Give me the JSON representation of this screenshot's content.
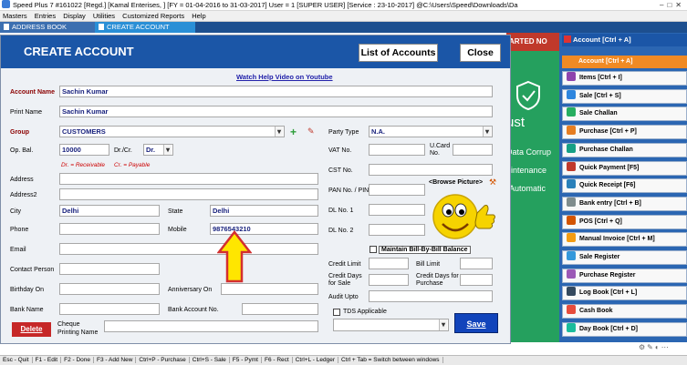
{
  "titlebar": {
    "text": "Speed Plus 7 #161022  [Regd.]  [Kamal Enterises, ]  [FY = 01-04-2016 to 31-03-2017]  User = 1 [SUPER USER]   [Service : 23-10-2017]  @C:\\Users\\Speed\\Downloads\\Da"
  },
  "menu": [
    "Masters",
    "Entries",
    "Display",
    "Utilities",
    "Customized Reports",
    "Help"
  ],
  "tabs": [
    "ADDRESS BOOK",
    "CREATE ACCOUNT"
  ],
  "dialog": {
    "title": "CREATE ACCOUNT",
    "list_btn": "List of Accounts",
    "close_btn": "Close",
    "help_link": "Watch Help Video on Youtube",
    "labels": {
      "account_name": "Account Name",
      "print_name": "Print Name",
      "group": "Group",
      "op_bal": "Op. Bal.",
      "drcr": "Dr./Cr.",
      "address": "Address",
      "address2": "Address2",
      "city": "City",
      "state": "State",
      "phone": "Phone",
      "mobile": "Mobile",
      "email": "Email",
      "contact": "Contact Person",
      "birthday": "Birthday On",
      "anniversary": "Anniversary On",
      "bank_name": "Bank Name",
      "bank_acc": "Bank Account No.",
      "cheque": "Cheque Printing Name",
      "party_type": "Party Type",
      "vat": "VAT No.",
      "ucard": "U.Card No.",
      "cst": "CST No.",
      "pan": "PAN No. / PIN",
      "dl1": "DL No. 1",
      "dl2": "DL No. 2",
      "browse": "<Browse Picture>",
      "maintain": "Maintain Bill-By-Bill Balance",
      "credit_limit": "Credit Limit",
      "bill_limit": "Bill Limit",
      "credit_days_sale": "Credit Days for Sale",
      "credit_days_purchase": "Credit Days for Purchase",
      "audit": "Audit Upto",
      "tds": "TDS Applicable"
    },
    "values": {
      "account_name": "Sachin Kumar",
      "print_name": "Sachin Kumar",
      "group": "CUSTOMERS",
      "op_bal": "10000",
      "drcr": "Dr.",
      "city": "Delhi",
      "state": "Delhi",
      "mobile": "9876543210",
      "party_type": "N.A."
    },
    "hint_dr": "Dr. = Receivable",
    "hint_cr": "Cr. = Payable",
    "delete_btn": "Delete",
    "save_btn": "Save"
  },
  "background": {
    "bar_text": "ARTED NO",
    "line1": "ust",
    "line2": "Data Corrup",
    "line3": "aintenance",
    "line4": "Automatic"
  },
  "rpanel": {
    "header": "Account [Ctrl + A]",
    "selected": "Account [Ctrl + A]",
    "items": [
      {
        "label": "Items [Ctrl + I]",
        "color": "#8e44ad"
      },
      {
        "label": "Sale [Ctrl + S]",
        "color": "#2e86de"
      },
      {
        "label": "Sale Challan",
        "color": "#27ae60"
      },
      {
        "label": "Purchase [Ctrl + P]",
        "color": "#e67e22"
      },
      {
        "label": "Purchase Challan",
        "color": "#16a085"
      },
      {
        "label": "Quick Payment [F5]",
        "color": "#c0392b"
      },
      {
        "label": "Quick Receipt [F6]",
        "color": "#2980b9"
      },
      {
        "label": "Bank entry [Ctrl + B]",
        "color": "#7f8c8d"
      },
      {
        "label": "POS [Ctrl + Q]",
        "color": "#d35400"
      },
      {
        "label": "Manual Invoice [Ctrl + M]",
        "color": "#f39c12"
      },
      {
        "label": "Sale Register",
        "color": "#3498db"
      },
      {
        "label": "Purchase Register",
        "color": "#9b59b6"
      },
      {
        "label": "Log Book [Ctrl + L]",
        "color": "#34495e"
      },
      {
        "label": "Cash Book",
        "color": "#e74c3c"
      },
      {
        "label": "Day Book [Ctrl + D]",
        "color": "#1abc9c"
      }
    ]
  },
  "statusbar": [
    "Esc - Quit",
    "F1 - Edit",
    "F2 - Done",
    "F3 - Add New",
    "Ctrl+P - Purchase",
    "Ctrl+S - Sale",
    "F5 - Pymt",
    "F6 - Rect",
    "Ctrl+L - Ledger",
    "Ctrl + Tab = Switch between windows"
  ]
}
